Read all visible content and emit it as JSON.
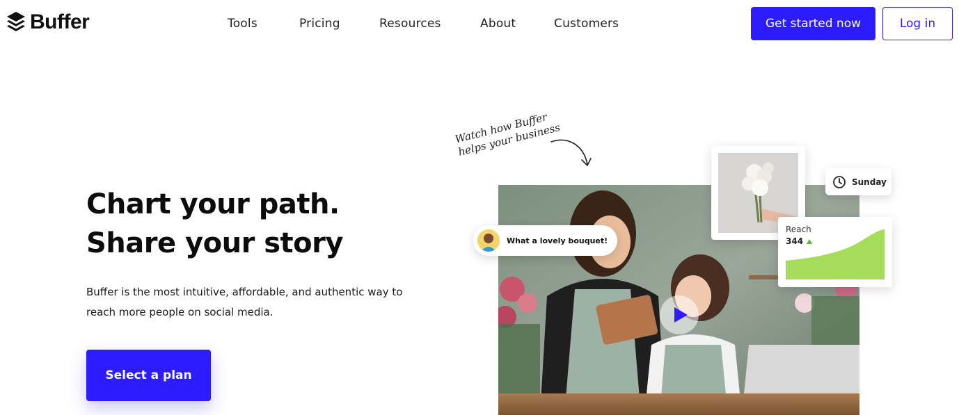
{
  "header": {
    "logo_text": "Buffer",
    "nav": [
      "Tools",
      "Pricing",
      "Resources",
      "About",
      "Customers"
    ],
    "cta_primary": "Get started now",
    "cta_secondary": "Log in"
  },
  "hero": {
    "title_line1": "Chart your path.",
    "title_line2": "Share your story",
    "subtitle": "Buffer is the most intuitive, affordable, and authentic way to reach more people on social media.",
    "cta": "Select a plan"
  },
  "media": {
    "handwritten_line1": "Watch how Buffer",
    "handwritten_line2": "helps your business",
    "comment_text": "What a lovely bouquet!",
    "schedule_day": "Sunday",
    "reach_label": "Reach",
    "reach_value": "344",
    "reach_trend": "up",
    "icons": [
      "buffer-logo-icon",
      "clock-icon",
      "play-icon",
      "trend-up-icon",
      "curved-arrow-icon"
    ]
  },
  "colors": {
    "brand": "#2c1cff",
    "chart_fill": "#a5dc5a",
    "trend_up": "#58b53a",
    "text_dark": "#0c0c0c"
  }
}
